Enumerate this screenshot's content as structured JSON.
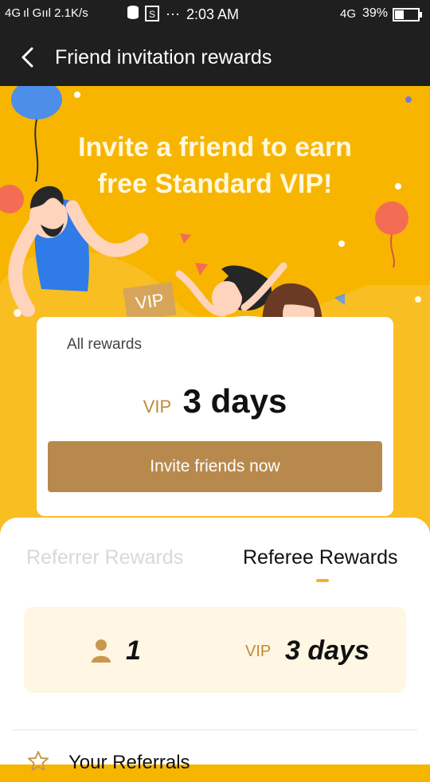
{
  "status_bar": {
    "left": "4G ıl  Gııl  2.1K/s",
    "time": "2:03 AM",
    "network": "4G",
    "battery": "39%"
  },
  "header": {
    "title": "Friend invitation rewards"
  },
  "hero": {
    "headline_line1": "Invite a friend to earn",
    "headline_line2": "free Standard VIP!",
    "vip_stamp": "VIP"
  },
  "reward_card": {
    "label": "All rewards",
    "vip_label": "VIP",
    "value": "3 days",
    "button": "Invite friends now"
  },
  "tabs": [
    {
      "label": "Referrer Rewards",
      "active": false
    },
    {
      "label": "Referee Rewards",
      "active": true
    }
  ],
  "stats": {
    "count": "1",
    "vip_label": "VIP",
    "days": "3 days"
  },
  "referrals": {
    "label": "Your Referrals"
  },
  "colors": {
    "brand": "#f8b500",
    "button": "#b8894d",
    "accent_text": "#c18a35"
  }
}
